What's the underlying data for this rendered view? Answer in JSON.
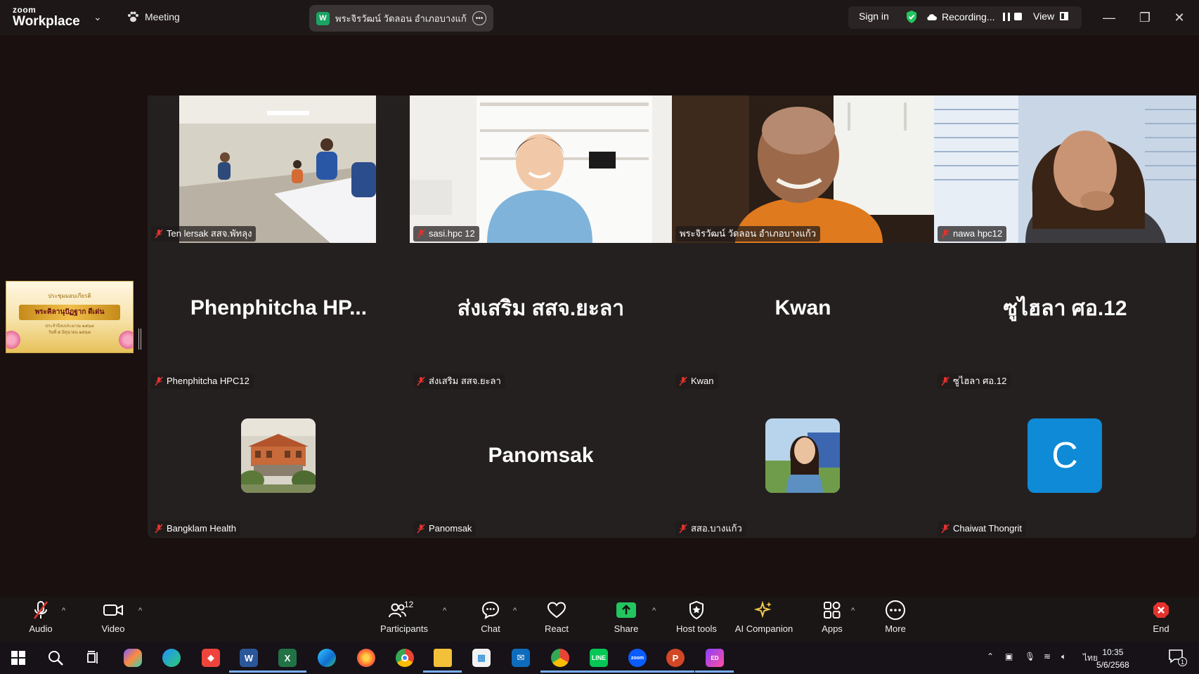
{
  "app": {
    "brand_top": "zoom",
    "brand_bottom": "Workplace",
    "meeting_label": "Meeting",
    "meeting_tab_badge": "W",
    "meeting_tab_title": "พระจิรวัฒน์ วัดลอน อำเภอบางแก้ว's s",
    "sign_in": "Sign in",
    "recording": "Recording...",
    "view": "View"
  },
  "sidebar": {
    "thumb_top": "ประชุมมอบเกียรติ",
    "thumb_title": "พระคิลานุปัฏฐาก ดีเด่น",
    "thumb_sub1": "ประจำปีงบประมาณ ๒๕๖๘",
    "thumb_sub2": "วันที่ ๕ มิถุนายน ๒๕๖๘"
  },
  "participants": [
    {
      "name": "Ten lersak สสจ.พัทลุง",
      "kind": "video",
      "muted": true
    },
    {
      "name": "sasi.hpc 12",
      "kind": "video",
      "muted": true
    },
    {
      "name": "พระจิรวัฒน์ วัดลอน อำเภอบางแก้ว",
      "kind": "video",
      "muted": false,
      "active": true
    },
    {
      "name": "nawa hpc12",
      "kind": "video",
      "muted": true
    },
    {
      "name": "Phenphitcha HPC12",
      "display": "Phenphitcha  HP...",
      "kind": "name",
      "muted": true
    },
    {
      "name": "ส่งเสริม สสจ.ยะลา",
      "display": "ส่งเสริม สสจ.ยะลา",
      "kind": "name",
      "muted": true
    },
    {
      "name": "Kwan",
      "display": "Kwan",
      "kind": "name",
      "muted": true
    },
    {
      "name": "ซูไฮลา ศอ.12",
      "display": "ซูไฮลา ศอ.12",
      "kind": "name",
      "muted": true
    },
    {
      "name": "Bangklam Health",
      "kind": "photo",
      "muted": true
    },
    {
      "name": "Panomsak",
      "display": "Panomsak",
      "kind": "name",
      "muted": true
    },
    {
      "name": "สสอ.บางแก้ว",
      "kind": "photo",
      "muted": true
    },
    {
      "name": "Chaiwat Thongrit",
      "avatar_letter": "C",
      "kind": "letter",
      "muted": true
    }
  ],
  "toolbar": {
    "audio": "Audio",
    "video": "Video",
    "participants": "Participants",
    "participants_count": "12",
    "chat": "Chat",
    "react": "React",
    "share": "Share",
    "host_tools": "Host tools",
    "ai_companion": "AI Companion",
    "apps": "Apps",
    "more": "More",
    "end": "End"
  },
  "taskbar": {
    "lang": "ไทย",
    "time": "10:35",
    "date": "5/6/2568",
    "notif_count": "1"
  },
  "colors": {
    "active_speaker": "#22c55e",
    "share_green": "#22c55e",
    "end_red": "#e5322d",
    "avatar_blue": "#0e8ad6"
  }
}
